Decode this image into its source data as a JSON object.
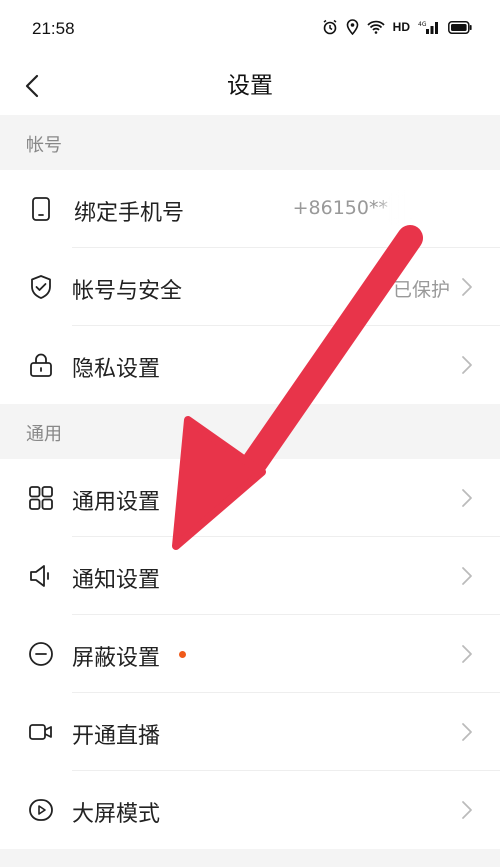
{
  "status_bar": {
    "time": "21:58",
    "network": "HD"
  },
  "nav": {
    "title": "设置"
  },
  "sections": [
    {
      "header": "帐号"
    },
    {
      "header": "通用"
    }
  ],
  "account": {
    "phone_label": "绑定手机号",
    "phone_value": "+86150**",
    "security_label": "帐号与安全",
    "security_value": "已保护",
    "privacy_label": "隐私设置"
  },
  "general": {
    "general_label": "通用设置",
    "notify_label": "通知设置",
    "block_label": "屏蔽设置",
    "live_label": "开通直播",
    "bigscreen_label": "大屏模式"
  },
  "colors": {
    "accent_dot": "#f05a1a",
    "annotation_arrow": "#e8344a"
  }
}
